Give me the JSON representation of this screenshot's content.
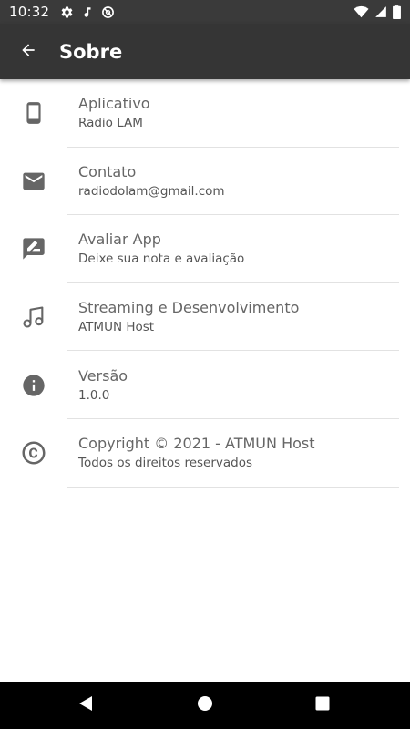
{
  "status_bar": {
    "time": "10:32",
    "left_icons": [
      "settings-icon",
      "music-note-icon",
      "do-not-disturb-icon"
    ],
    "right_icons": [
      "wifi-icon",
      "signal-icon",
      "battery-icon"
    ]
  },
  "app_bar": {
    "title": "Sobre",
    "back_icon": "arrow-back-icon"
  },
  "items": [
    {
      "icon": "smartphone-icon",
      "title": "Aplicativo",
      "subtitle": "Radio LAM"
    },
    {
      "icon": "email-icon",
      "title": "Contato",
      "subtitle": "radiodolam@gmail.com"
    },
    {
      "icon": "rate-review-icon",
      "title": "Avaliar App",
      "subtitle": "Deixe sua nota e avaliação"
    },
    {
      "icon": "music-notes-icon",
      "title": "Streaming e Desenvolvimento",
      "subtitle": "ATMUN Host"
    },
    {
      "icon": "info-icon",
      "title": "Versão",
      "subtitle": "1.0.0"
    },
    {
      "icon": "copyright-icon",
      "title": "Copyright © 2021 - ATMUN Host",
      "subtitle": "Todos os direitos reservados"
    }
  ],
  "nav_bar": {
    "buttons": [
      "back-triangle-icon",
      "home-circle-icon",
      "recents-square-icon"
    ]
  },
  "colors": {
    "status_bar": "#3a3a3a",
    "app_bar": "#353535",
    "icon": "#666666",
    "title_text": "#666666",
    "subtitle_text": "#555555",
    "divider": "#e2e2e2",
    "nav_bar": "#000000"
  }
}
